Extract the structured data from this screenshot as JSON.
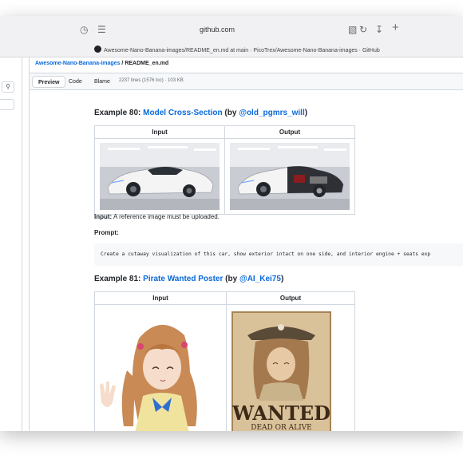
{
  "browser": {
    "url": "github.com",
    "tab_title": "Awesome-Nano-Banana-images/README_en.md at main · PicoTrex/Awesome-Nano-Banana-images · GitHub"
  },
  "breadcrumb": {
    "repo": "Awesome-Nano-Banana-images",
    "separator": " / ",
    "file": "README_en.md"
  },
  "toolbar": {
    "tabs": [
      "Preview",
      "Code",
      "Blame"
    ],
    "file_info": "2237 lines (1576 loc) · 103 KB"
  },
  "examples": [
    {
      "heading_prefix": "Example 80: ",
      "title": "Model Cross-Section",
      "by_open": " (by ",
      "author": "@old_pgmrs_will",
      "by_close": ")",
      "col_input": "Input",
      "col_output": "Output",
      "input_label": "Input:",
      "input_text": " A reference image must be uploaded.",
      "prompt_label": "Prompt:",
      "prompt_code": "Create a cutaway visualization of this car, show exterior intact on one side, and interior engine + seats exp"
    },
    {
      "heading_prefix": "Example 81: ",
      "title": "Pirate Wanted Poster",
      "by_open": " (by ",
      "author": "@AI_Kei75",
      "by_close": ")",
      "col_input": "Input",
      "col_output": "Output",
      "poster_title": "WANTED",
      "poster_sub": "DEAD OR ALIVE"
    }
  ]
}
